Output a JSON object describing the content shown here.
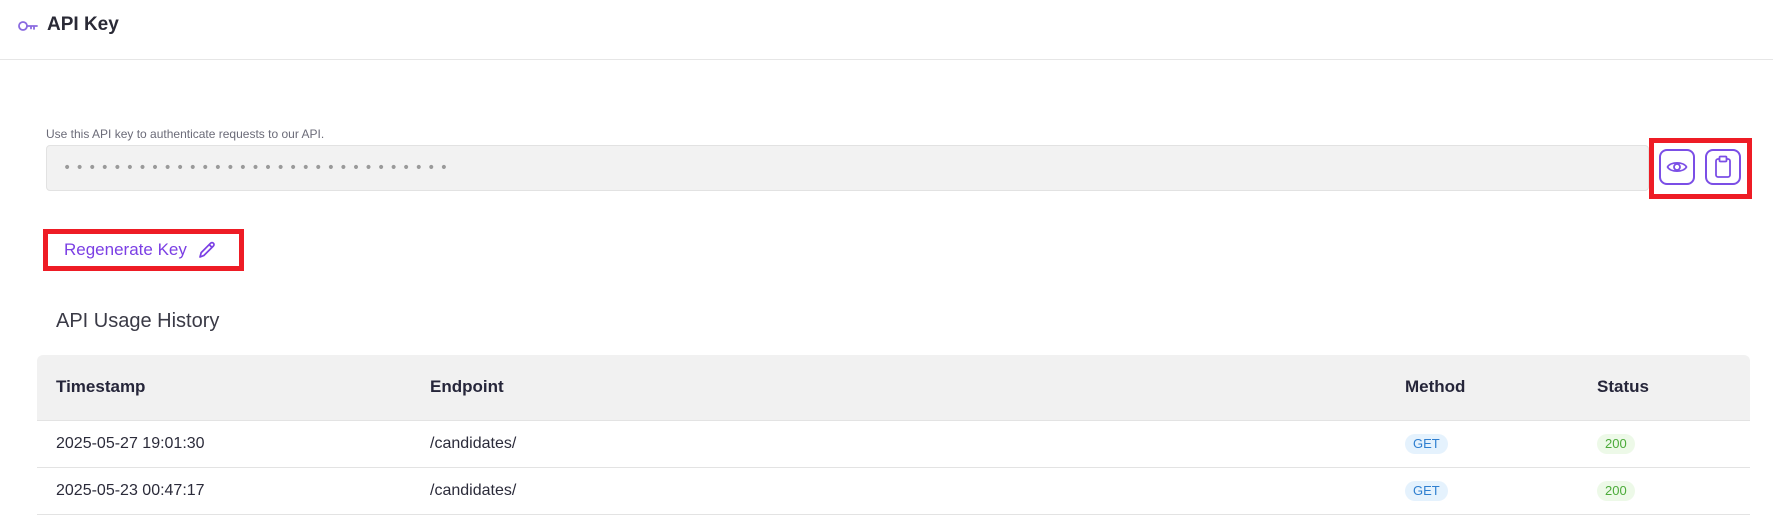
{
  "header": {
    "icon": "key-icon",
    "title": "API Key"
  },
  "api_key": {
    "helper_text": "Use this API key to authenticate requests to our API.",
    "masked_value": "•••••••••••••••••••••••••••••••",
    "show_icon": "eye-icon",
    "copy_icon": "clipboard-icon"
  },
  "regenerate": {
    "label": "Regenerate Key",
    "icon": "pencil-icon"
  },
  "history": {
    "title": "API Usage History",
    "columns": [
      "Timestamp",
      "Endpoint",
      "Method",
      "Status"
    ],
    "rows": [
      {
        "timestamp": "2025-05-27 19:01:30",
        "endpoint": "/candidates/",
        "method": "GET",
        "status": "200"
      },
      {
        "timestamp": "2025-05-23 00:47:17",
        "endpoint": "/candidates/",
        "method": "GET",
        "status": "200"
      }
    ]
  },
  "colors": {
    "accent": "#7b3fe4",
    "highlight": "#ee1c25",
    "method_badge_bg": "#e5f2fd",
    "method_badge_text": "#2f7fd0",
    "status_badge_bg": "#edf9e8",
    "status_badge_text": "#4cab3a"
  }
}
